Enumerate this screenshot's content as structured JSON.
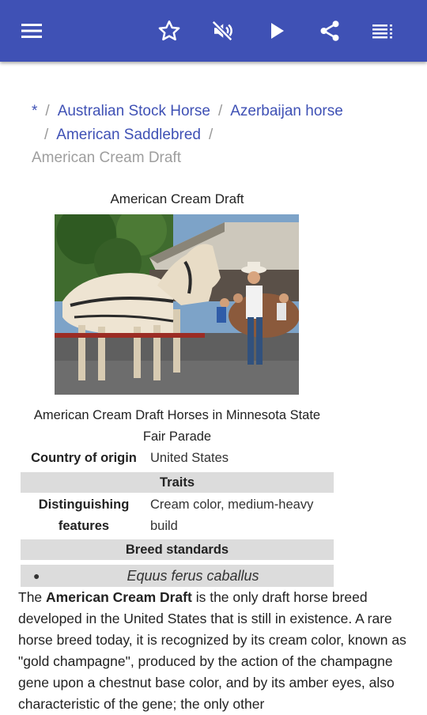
{
  "appbar": {
    "color": "#3f51b5",
    "icons": [
      "menu-icon",
      "star-icon",
      "volume-off-icon",
      "play-icon",
      "share-icon",
      "toc-icon"
    ]
  },
  "breadcrumb": {
    "home": "*",
    "items": [
      "Australian Stock Horse",
      "Azerbaijan horse",
      "American Saddlebred"
    ],
    "current": "American Cream Draft",
    "separator": "/"
  },
  "infobox": {
    "title": "American Cream Draft",
    "caption": "American Cream Draft Horses in Minnesota State Fair Parade",
    "country_label": "Country of origin",
    "country_value": "United States",
    "traits_header": "Traits",
    "features_label": "Distinguishing features",
    "features_value": "Cream color, medium-heavy build",
    "standards_header": "Breed standards",
    "species": "Equus ferus caballus"
  },
  "article": {
    "intro_the": "The",
    "intro_bold": "American Cream Draft",
    "intro_rest": "is the only draft horse breed developed in the United States that is still in existence. A rare horse breed today, it is recognized by its cream color, known as \"gold champagne\", produced by the action of the champagne gene upon a chestnut base color, and by its amber eyes, also characteristic of the gene; the only other"
  }
}
